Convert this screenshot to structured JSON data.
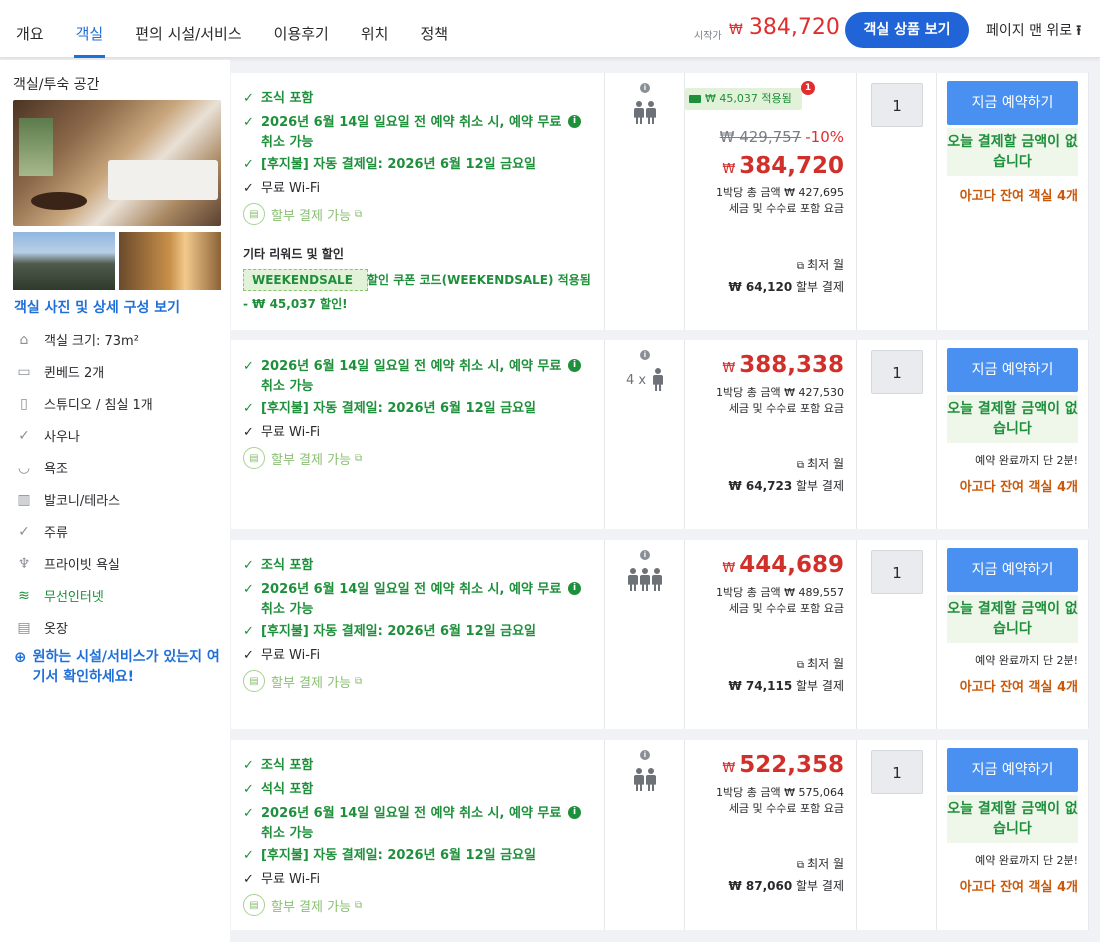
{
  "nav": {
    "tabs": [
      "개요",
      "객실",
      "편의 시설/서비스",
      "이용후기",
      "위치",
      "정책"
    ],
    "from_label": "시작가",
    "currency": "₩",
    "from_price": "384,720",
    "view_button": "객실 상품 보기",
    "top_link": "페이지 맨 위로"
  },
  "sidebar": {
    "title": "객실/투숙 공간",
    "photos_link": "객실 사진 및 상세 구성 보기",
    "features": [
      {
        "icon": "room-size-icon",
        "label": "객실 크기: 73m²"
      },
      {
        "icon": "bed-icon",
        "label": "퀸베드 2개"
      },
      {
        "icon": "door-icon",
        "label": "스튜디오 / 침실 1개"
      },
      {
        "icon": "check-icon",
        "label": "사우나"
      },
      {
        "icon": "bathtub-icon",
        "label": "욕조"
      },
      {
        "icon": "balcony-icon",
        "label": "발코니/테라스"
      },
      {
        "icon": "check-icon",
        "label": "주류"
      },
      {
        "icon": "shower-icon",
        "label": "프라이빗 욕실"
      },
      {
        "icon": "wifi-icon",
        "label": "무선인터넷"
      },
      {
        "icon": "wardrobe-icon",
        "label": "옷장"
      }
    ],
    "more_link": "원하는 시설/서비스가 있는지 여기서 확인하세요!"
  },
  "common": {
    "installment": "할부 결제 가능",
    "per_night_label": "1박당 총 금액",
    "tax_note": "세금 및 수수료 포함 요금",
    "monthly_label": "최저 월",
    "monthly_suffix": "할부 결제",
    "book_label": "지금 예약하기",
    "pay_today": "오늘 결제할 금액이 없습니다",
    "almost": "예약 완료까지 단 2분!",
    "rooms_left": "아고다 잔여 객실 4개"
  },
  "rooms": [
    {
      "benefits": [
        "조식 포함",
        "2026년 6월 14일 일요일 전 예약 취소 시, 예약 무료 취소 가능",
        "[후지불] 자동 결제일: 2026년 6월 12일 금요일",
        "무료 Wi-Fi"
      ],
      "other_label": "기타 리워드 및 할인",
      "coupon_code": "WEEKENDSALE",
      "coupon_text": "할인 쿠폰 코드(WEEKENDSALE) 적용됨",
      "coupon_discount": "- ₩ 45,037 할인!",
      "applied": "₩ 45,037 적용됨",
      "badge": "1",
      "original": "₩ 429,757",
      "discount_pct": "-10%",
      "price": "384,720",
      "per_night": "₩ 427,695",
      "monthly": "₩ 64,120",
      "qty": "1"
    },
    {
      "benefits": [
        "2026년 6월 14일 일요일 전 예약 취소 시, 예약 무료 취소 가능",
        "[후지불] 자동 결제일: 2026년 6월 12일 금요일",
        "무료 Wi-Fi"
      ],
      "occupancy_prefix": "4 x",
      "price": "388,338",
      "per_night": "₩ 427,530",
      "monthly": "₩ 64,723",
      "qty": "1"
    },
    {
      "benefits": [
        "조식 포함",
        "2026년 6월 14일 일요일 전 예약 취소 시, 예약 무료 취소 가능",
        "[후지불] 자동 결제일: 2026년 6월 12일 금요일",
        "무료 Wi-Fi"
      ],
      "price": "444,689",
      "per_night": "₩ 489,557",
      "monthly": "₩ 74,115",
      "qty": "1"
    },
    {
      "benefits": [
        "조식 포함",
        "석식 포함",
        "2026년 6월 14일 일요일 전 예약 취소 시, 예약 무료 취소 가능",
        "[후지불] 자동 결제일: 2026년 6월 12일 금요일",
        "무료 Wi-Fi"
      ],
      "price": "522,358",
      "per_night": "₩ 575,064",
      "monthly": "₩ 87,060",
      "qty": "1"
    }
  ]
}
